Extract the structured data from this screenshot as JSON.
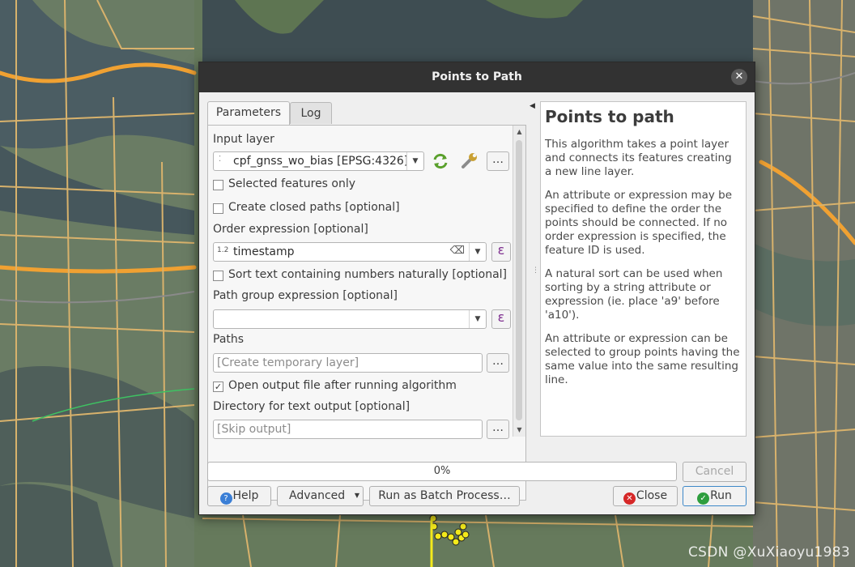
{
  "dialog": {
    "title": "Points to Path"
  },
  "tabs": [
    {
      "label": "Parameters"
    },
    {
      "label": "Log"
    }
  ],
  "params": {
    "input_layer_label": "Input layer",
    "input_layer_value": "cpf_gnss_wo_bias [EPSG:4326]",
    "selected_only_label": "Selected features only",
    "closed_paths_label": "Create closed paths [optional]",
    "order_expr_label": "Order expression [optional]",
    "order_expr_value": "timestamp",
    "order_expr_type_tag": "1.2",
    "sort_naturally_label": "Sort text containing numbers naturally [optional]",
    "group_expr_label": "Path group expression [optional]",
    "group_expr_value": "",
    "paths_label": "Paths",
    "paths_placeholder": "[Create temporary layer]",
    "open_output_label": "Open output file after running algorithm",
    "open_output_checked": true,
    "dir_label": "Directory for text output [optional]",
    "dir_placeholder": "[Skip output]",
    "ellipsis": "…",
    "expr_glyph": "ε"
  },
  "help": {
    "title": "Points to path",
    "paragraphs": [
      "This algorithm takes a point layer and connects its features creating a new line layer.",
      "An attribute or expression may be specified to define the order the points should be connected. If no order expression is specified, the feature ID is used.",
      "A natural sort can be used when sorting by a string attribute or expression (ie. place 'a9' before 'a10').",
      "An attribute or expression can be selected to group points having the same value into the same resulting line."
    ]
  },
  "progress": {
    "text": "0%",
    "value": 0
  },
  "buttons": {
    "cancel": "Cancel",
    "help": "Help",
    "advanced": "Advanced",
    "batch": "Run as Batch Process…",
    "close": "Close",
    "run": "Run"
  },
  "watermark": "CSDN @XuXiaoyu1983",
  "colors": {
    "accent": "#3d88c8",
    "run_icon": "#2e9e3e",
    "close_icon": "#d62828",
    "help_icon": "#3b7fd6",
    "titlebar": "#323232"
  }
}
